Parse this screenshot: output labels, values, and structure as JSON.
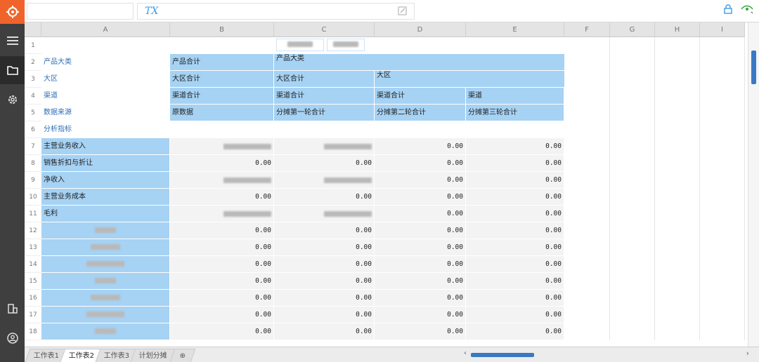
{
  "toolbar": {
    "fx_label": "TX"
  },
  "columns": [
    "A",
    "B",
    "C",
    "D",
    "E",
    "F",
    "G",
    "H",
    "I"
  ],
  "rows": [
    {
      "n": "1",
      "label": "",
      "b": "",
      "c": "",
      "d": "",
      "e": ""
    },
    {
      "n": "2",
      "label": "产品大类",
      "b": "产品合计",
      "c": "产品大类",
      "d": "",
      "e": ""
    },
    {
      "n": "3",
      "label": "大区",
      "b": "大区合计",
      "c": "大区合计",
      "d": "大区",
      "e": ""
    },
    {
      "n": "4",
      "label": "渠道",
      "b": "渠道合计",
      "c": "渠道合计",
      "d": "渠道合计",
      "e": "渠道"
    },
    {
      "n": "5",
      "label": "数据来源",
      "b": "原数据",
      "c": "分摊第一轮合计",
      "d": "分摊第二轮合计",
      "e": "分摊第三轮合计"
    },
    {
      "n": "6",
      "label": "分析指标",
      "b": "",
      "c": "",
      "d": "",
      "e": ""
    },
    {
      "n": "7",
      "label": "主营业务收入",
      "b": "",
      "c": "",
      "d": "0.00",
      "e": "0.00"
    },
    {
      "n": "8",
      "label": "销售折扣与折让",
      "b": "0.00",
      "c": "0.00",
      "d": "0.00",
      "e": "0.00"
    },
    {
      "n": "9",
      "label": "净收入",
      "b": "",
      "c": "",
      "d": "0.00",
      "e": "0.00"
    },
    {
      "n": "10",
      "label": "主营业务成本",
      "b": "0.00",
      "c": "0.00",
      "d": "0.00",
      "e": "0.00"
    },
    {
      "n": "11",
      "label": "毛利",
      "b": "",
      "c": "",
      "d": "0.00",
      "e": "0.00"
    },
    {
      "n": "12",
      "label": "",
      "b": "0.00",
      "c": "0.00",
      "d": "0.00",
      "e": "0.00"
    },
    {
      "n": "13",
      "label": "",
      "b": "0.00",
      "c": "0.00",
      "d": "0.00",
      "e": "0.00"
    },
    {
      "n": "14",
      "label": "",
      "b": "0.00",
      "c": "0.00",
      "d": "0.00",
      "e": "0.00"
    },
    {
      "n": "15",
      "label": "",
      "b": "0.00",
      "c": "0.00",
      "d": "0.00",
      "e": "0.00"
    },
    {
      "n": "16",
      "label": "",
      "b": "0.00",
      "c": "0.00",
      "d": "0.00",
      "e": "0.00"
    },
    {
      "n": "17",
      "label": "",
      "b": "0.00",
      "c": "0.00",
      "d": "0.00",
      "e": "0.00"
    },
    {
      "n": "18",
      "label": "",
      "b": "0.00",
      "c": "0.00",
      "d": "0.00",
      "e": "0.00"
    }
  ],
  "sheets": [
    "工作表1",
    "工作表2",
    "工作表3",
    "计划分摊"
  ],
  "active_sheet": "工作表2",
  "colors": {
    "accent": "#f0642b",
    "selection": "#a6d2f4",
    "rail": "#3f3f3f",
    "scroll": "#3b78c2"
  }
}
